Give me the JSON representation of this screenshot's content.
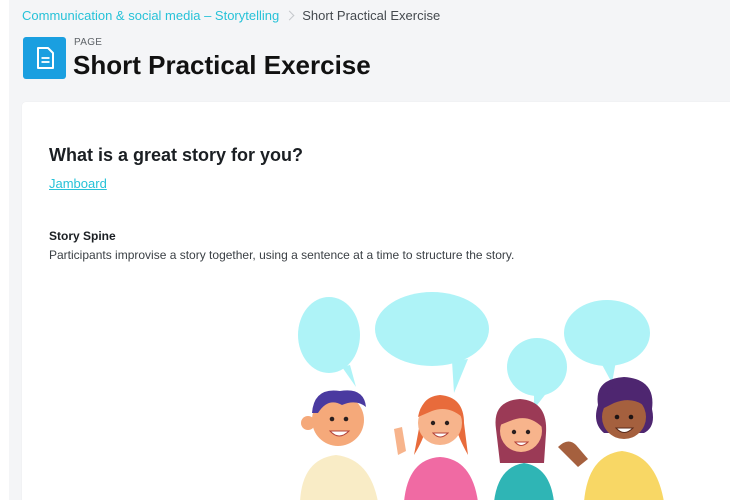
{
  "breadcrumb": {
    "parent": "Communication & social media – Storytelling",
    "current": "Short Practical Exercise"
  },
  "header": {
    "icon": "document-icon",
    "type_label": "PAGE",
    "title": "Short Practical Exercise"
  },
  "content": {
    "heading": "What is a great story for you?",
    "link": "Jamboard",
    "subheading": "Story Spine",
    "description": "Participants improvise a story together, using a sentence  at a time to structure the story."
  },
  "colors": {
    "accent": "#27c2d8",
    "icon_bg": "#1a9fe0",
    "speech_bubble": "#aef3f7"
  }
}
